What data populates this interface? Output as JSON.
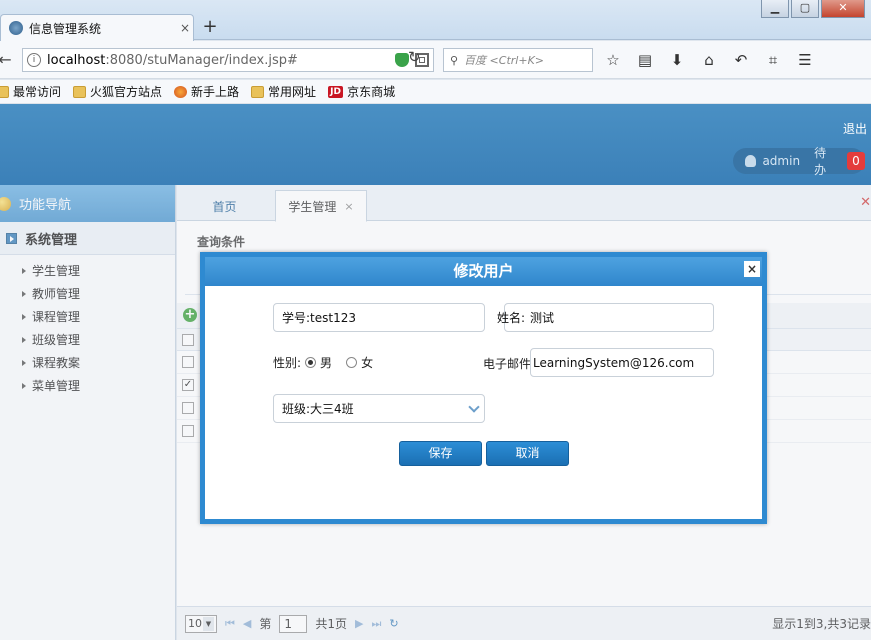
{
  "browser": {
    "tab_title": "信息管理系统",
    "tab_close": "×",
    "new_tab": "+",
    "url_host": "localhost",
    "url_rest": ":8080/stuManager/index.jsp#",
    "search_placeholder": "百度 <Ctrl+K>",
    "window_controls": [
      "▁",
      "▢",
      "✕"
    ],
    "bookmarks": [
      {
        "label": "最常访问",
        "icon": "folder"
      },
      {
        "label": "火狐官方站点",
        "icon": "folder"
      },
      {
        "label": "新手上路",
        "icon": "fox"
      },
      {
        "label": "常用网址",
        "icon": "folder"
      },
      {
        "label": "京东商城",
        "icon": "jd"
      }
    ],
    "jd_icon_text": "JD"
  },
  "header": {
    "logout": "退出",
    "user": "admin",
    "pending_label": "待办",
    "pending_count": "0"
  },
  "sidebar": {
    "title": "功能导航",
    "group": "系统管理",
    "items": [
      "学生管理",
      "教师管理",
      "课程管理",
      "班级管理",
      "课程教案",
      "菜单管理"
    ]
  },
  "main": {
    "tabs": [
      {
        "label": "首页"
      },
      {
        "label": "学生管理",
        "close": "×"
      }
    ],
    "close_mark": "✕",
    "query_title": "查询条件",
    "rows_checked": [
      false,
      true,
      false,
      false
    ]
  },
  "pager": {
    "page_size": "10",
    "page_label": "第",
    "page_value": "1",
    "total_pages": "共1页",
    "info": "显示1到3,共3记录"
  },
  "modal": {
    "title": "修改用户",
    "close": "×",
    "student_id_label": "学号:",
    "student_id_value": "test123",
    "name_label": "姓名:",
    "name_value": "测试",
    "gender_label": "性别:",
    "gender_male": "男",
    "gender_female": "女",
    "gender_selected": "男",
    "email_label": "电子邮件:",
    "email_value": "LearningSystem@126.com",
    "class_label": "班级:",
    "class_value": "大三4班",
    "save": "保存",
    "cancel": "取消"
  },
  "colors": {
    "header_blue": "#3b80b8",
    "modal_border": "#2e8ad1",
    "button_blue": "#1b6fb3",
    "badge_red": "#e43c3c"
  }
}
